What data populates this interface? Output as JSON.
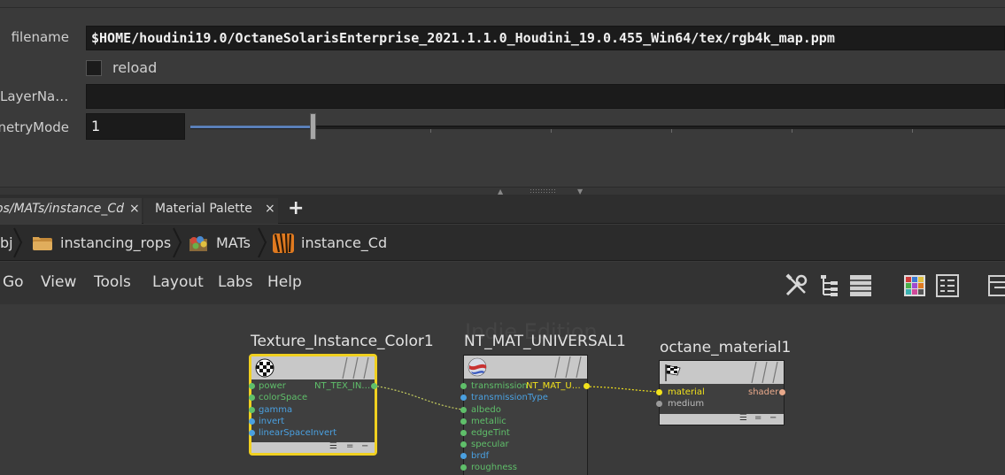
{
  "parameters": {
    "filename": {
      "label": "filename",
      "value": "$HOME/houdini19.0/OctaneSolarisEnterprise_2021.1.1.0_Houdini_19.0.455_Win64/tex/rgb4k_map.ppm"
    },
    "reload": {
      "label": "reload",
      "checked": false
    },
    "layer_name": {
      "label": "LayerNa…",
      "value": ""
    },
    "geometry_mode": {
      "label": "netryMode",
      "value": "1",
      "slider_fraction": 0.15
    }
  },
  "tabs": [
    {
      "label": "ops/MATs/instance_Cd",
      "close": "×",
      "active": true
    },
    {
      "label": "Material Palette",
      "close": "×",
      "active": false
    }
  ],
  "tab_add": "+",
  "path": {
    "root": "bj",
    "items": [
      {
        "label": "instancing_rops",
        "icon": "folder-icon"
      },
      {
        "label": "MATs",
        "icon": "mats-icon"
      },
      {
        "label": "instance_Cd",
        "icon": "tiger-stripes-icon"
      }
    ]
  },
  "menu": [
    "Go",
    "View",
    "Tools",
    "Layout",
    "Labs",
    "Help"
  ],
  "toolbar_icons": [
    "wrench-screwdriver-icon",
    "tree-view-icon",
    "list-view-icon",
    "color-grid-icon",
    "parameter-view-icon",
    "panel-icon"
  ],
  "watermark": "Indie Edition",
  "nodes": [
    {
      "title": "Texture_Instance_Color1",
      "icon": "checker-icon",
      "selected": true,
      "inputs": [
        {
          "name": "power",
          "color": "#5fbf6a"
        },
        {
          "name": "colorSpace",
          "color": "#5fbf6a"
        },
        {
          "name": "gamma",
          "color": "#4aa0e0"
        },
        {
          "name": "invert",
          "color": "#4aa0e0"
        },
        {
          "name": "linearSpaceInvert",
          "color": "#4aa0e0"
        }
      ],
      "output": {
        "name": "NT_TEX_IN…",
        "color": "#5fbf6a"
      },
      "footer": [
        "☰",
        "=",
        "−"
      ]
    },
    {
      "title": "NT_MAT_UNIVERSAL1",
      "icon": "material-ball-icon",
      "selected": false,
      "inputs": [
        {
          "name": "transmission",
          "color": "#5fbf6a"
        },
        {
          "name": "transmissionType",
          "color": "#4aa0e0"
        },
        {
          "name": "albedo",
          "color": "#5fbf6a"
        },
        {
          "name": "metallic",
          "color": "#5fbf6a"
        },
        {
          "name": "edgeTint",
          "color": "#5fbf6a"
        },
        {
          "name": "specular",
          "color": "#5fbf6a"
        },
        {
          "name": "brdf",
          "color": "#4aa0e0"
        },
        {
          "name": "roughness",
          "color": "#5fbf6a"
        }
      ],
      "output": {
        "name": "NT_MAT_U…",
        "color": "#f2e21c"
      }
    },
    {
      "title": "octane_material1",
      "icon": "checkered-flag-icon",
      "selected": false,
      "inputs": [
        {
          "name": "material",
          "color": "#f2e21c"
        },
        {
          "name": "medium",
          "color": "#9a9a9a"
        }
      ],
      "output": {
        "name": "shader",
        "color": "#e8a88a"
      },
      "footer": [
        "☰",
        "=",
        "−"
      ]
    }
  ],
  "colors": {
    "selection": "#f0d020",
    "wire_green": "#c8d060",
    "wire_yellow": "#f2e21c",
    "slider_fill": "#5a7fb8"
  }
}
